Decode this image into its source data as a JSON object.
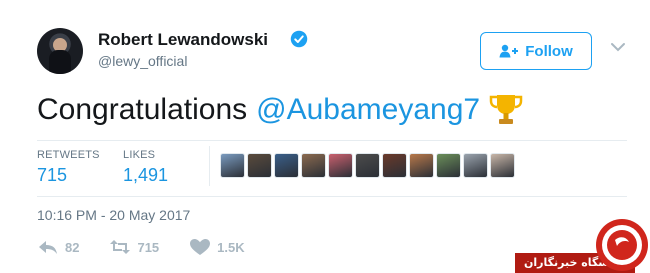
{
  "user": {
    "display_name": "Robert Lewandowski",
    "handle": "@lewy_official",
    "verified": true
  },
  "follow_button": {
    "label": "Follow",
    "icon": "add-user-icon"
  },
  "tweet": {
    "text": "Congratulations",
    "mention": "@Aubameyang7",
    "emoji": "trophy-icon"
  },
  "stats": {
    "retweets_label": "RETWEETS",
    "retweets_value": "715",
    "likes_label": "LIKES",
    "likes_value": "1,491"
  },
  "likers": [
    {
      "color": "#7a9bbf"
    },
    {
      "color": "#5a4b3c"
    },
    {
      "color": "#3a5f8a"
    },
    {
      "color": "#8b6a4f"
    },
    {
      "color": "#c9606e"
    },
    {
      "color": "#4c4c4c"
    },
    {
      "color": "#6a3a2a"
    },
    {
      "color": "#b7784a"
    },
    {
      "color": "#6b8f5a"
    },
    {
      "color": "#9aa3ad"
    },
    {
      "color": "#c8b6a8"
    }
  ],
  "timestamp": "10:16 PM - 20 May 2017",
  "actions": {
    "reply_count": "82",
    "retweet_count": "715",
    "like_count": "1.5K"
  },
  "watermark": {
    "text": "باشگاه خبرنگاران"
  },
  "colors": {
    "accent": "#1da1f2",
    "mention": "#1b95e0",
    "muted": "#657786",
    "watermark": "#b01b12"
  }
}
